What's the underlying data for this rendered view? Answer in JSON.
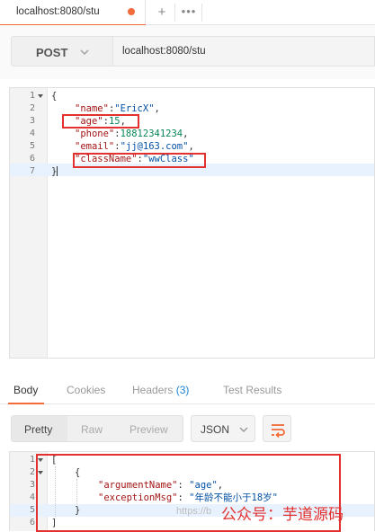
{
  "tab": {
    "label": "localhost:8080/stu",
    "new_tab": "+",
    "more": "•••"
  },
  "request": {
    "method": "POST",
    "url": "localhost:8080/stu"
  },
  "request_body": {
    "lines": [
      {
        "num": "1",
        "code": "{"
      },
      {
        "num": "2",
        "key": "\"name\"",
        "value": "\"EricX\"",
        "value_type": "string"
      },
      {
        "num": "3",
        "key": "\"age\"",
        "value": "15",
        "value_type": "number"
      },
      {
        "num": "4",
        "key": "\"phone\"",
        "value": "18812341234",
        "value_type": "number"
      },
      {
        "num": "5",
        "key": "\"email\"",
        "value": "\"jj@163.com\"",
        "value_type": "string"
      },
      {
        "num": "6",
        "key": "\"className\"",
        "value": "\"wwClass\"",
        "value_type": "string"
      },
      {
        "num": "7",
        "code": "}"
      }
    ]
  },
  "response_tabs": {
    "body": "Body",
    "cookies": "Cookies",
    "headers": "Headers",
    "headers_count": "(3)",
    "test_results": "Test Results"
  },
  "response_toolbar": {
    "pretty": "Pretty",
    "raw": "Raw",
    "preview": "Preview",
    "format": "JSON",
    "wrap_icon": "wrap-lines-icon"
  },
  "response_body": {
    "lines": [
      {
        "num": "1",
        "code": "["
      },
      {
        "num": "2",
        "code": "{"
      },
      {
        "num": "3",
        "key": "\"argumentName\"",
        "value": "\"age\""
      },
      {
        "num": "4",
        "key": "\"exceptionMsg\"",
        "value": "\"年龄不能小于18岁\""
      },
      {
        "num": "5",
        "code": "}"
      },
      {
        "num": "6",
        "code": "]"
      }
    ]
  },
  "watermark": {
    "url": "https://b",
    "text": "公众号：芋道源码"
  },
  "colors": {
    "accent": "#f26b3a",
    "highlight_box": "#e2312f",
    "key": "#a31515",
    "string": "#0451a5",
    "number": "#098658"
  }
}
